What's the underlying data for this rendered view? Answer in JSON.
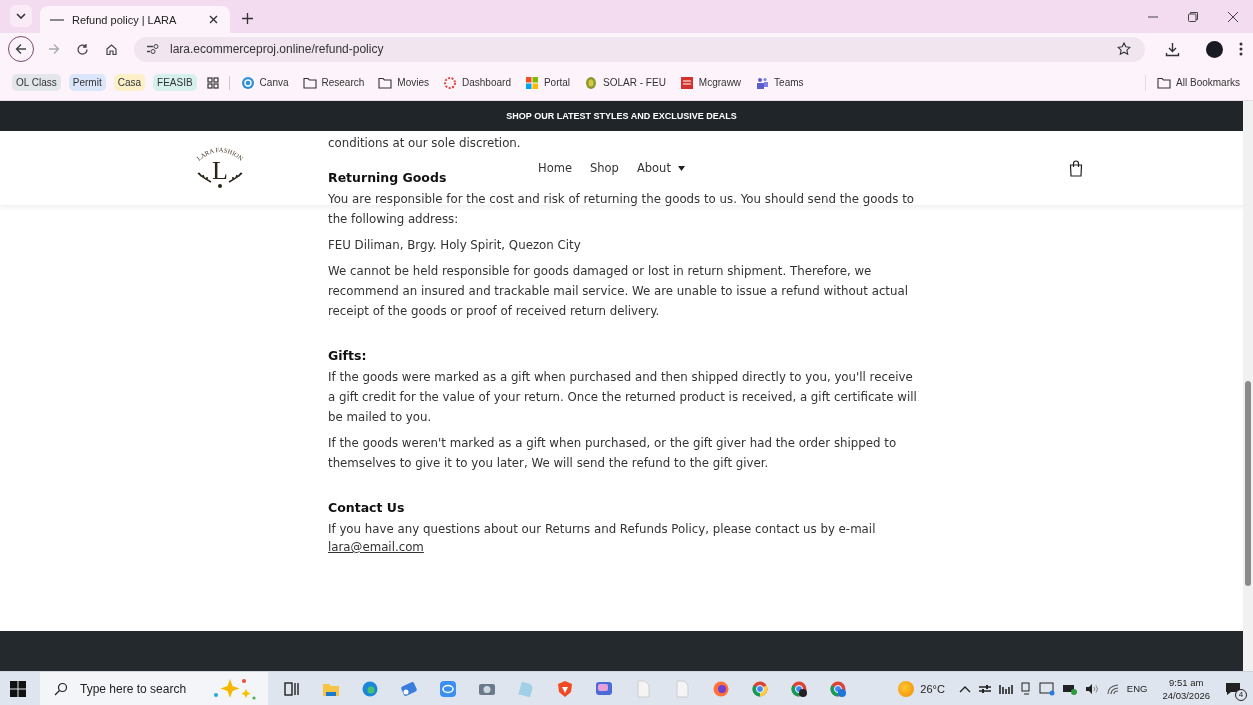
{
  "browser": {
    "tabs": [
      {
        "title": "Refund policy | LARA",
        "selected": true
      }
    ],
    "address": "lara.ecommerceproj.online/refund-policy",
    "bookmarks": [
      {
        "label": "OL Class",
        "kind": "group",
        "color": "#e3e6ea"
      },
      {
        "label": "Permit",
        "kind": "group",
        "color": "#dbe6fb"
      },
      {
        "label": "Casa",
        "kind": "group",
        "color": "#fbf0c8"
      },
      {
        "label": "FEASIB",
        "kind": "group",
        "color": "#d6f0ee"
      },
      {
        "kind": "apps"
      },
      {
        "label": "Canva",
        "kind": "site"
      },
      {
        "label": "Research",
        "kind": "folder"
      },
      {
        "label": "Movies",
        "kind": "folder"
      },
      {
        "label": "Dashboard",
        "kind": "site"
      },
      {
        "label": "Portal",
        "kind": "site"
      },
      {
        "label": "SOLAR - FEU",
        "kind": "site"
      },
      {
        "label": "Mcgraww",
        "kind": "site"
      },
      {
        "label": "Teams",
        "kind": "site"
      }
    ],
    "all_bookmarks": "All Bookmarks"
  },
  "page": {
    "banner": "SHOP OUR LATEST STYLES AND EXCLUSIVE DEALS",
    "logo": {
      "arc": "LARA FASHION",
      "letter": "L"
    },
    "nav": [
      {
        "label": "Home",
        "dropdown": false
      },
      {
        "label": "Shop",
        "dropdown": false
      },
      {
        "label": "About",
        "dropdown": true
      }
    ],
    "content": [
      {
        "kind": "paragraph",
        "text": "conditions at our sole discretion."
      },
      {
        "kind": "heading",
        "text": "Returning Goods"
      },
      {
        "kind": "paragraph",
        "text": "You are responsible for the cost and risk of returning the goods to us. You should send the goods to the following address:"
      },
      {
        "kind": "paragraph",
        "text": "FEU Diliman, Brgy. Holy Spirit, Quezon City"
      },
      {
        "kind": "paragraph",
        "text": "We cannot be held responsible for goods damaged or lost in return shipment. Therefore, we recommend an insured and trackable mail service. We are unable to issue a refund without actual receipt of the goods or proof of received return delivery."
      },
      {
        "kind": "heading",
        "text": "Gifts:"
      },
      {
        "kind": "paragraph",
        "text": "If the goods were marked as a gift when purchased and then shipped directly to you, you'll receive a gift credit for the value of your return. Once the returned product is received, a gift certificate will be mailed to you."
      },
      {
        "kind": "paragraph",
        "text": "If the goods weren't marked as a gift when purchased, or the gift giver had the order shipped to themselves to give it to you later, We will send the refund to the gift giver."
      },
      {
        "kind": "heading",
        "text": "Contact Us"
      },
      {
        "kind": "tight",
        "text": "If you have any questions about our Returns and Refunds Policy, please contact us by e-mail"
      },
      {
        "kind": "link",
        "text": "lara@email.com"
      }
    ]
  },
  "taskbar": {
    "search": {
      "placeholder": "Type here to search"
    },
    "weather": "26°C",
    "language": "ENG",
    "time": "9:51 am",
    "date": "24/03/2026",
    "notifications": "4"
  }
}
